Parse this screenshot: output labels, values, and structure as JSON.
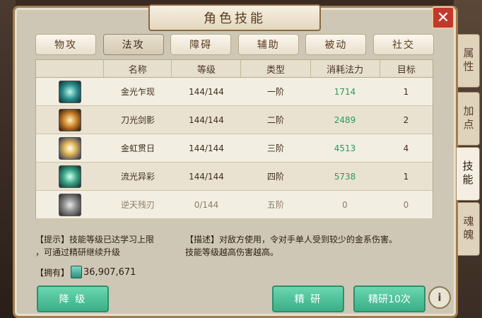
{
  "window": {
    "title": "角色技能",
    "close_label": "✕"
  },
  "tabs": [
    {
      "label": "物攻",
      "active": false
    },
    {
      "label": "法攻",
      "active": true
    },
    {
      "label": "障碍",
      "active": false
    },
    {
      "label": "辅助",
      "active": false
    },
    {
      "label": "被动",
      "active": false
    },
    {
      "label": "社交",
      "active": false
    }
  ],
  "table": {
    "headers": [
      "名称",
      "等级",
      "类型",
      "消耗法力",
      "目标"
    ],
    "rows": [
      {
        "icon": "skill-golden-light-icon",
        "name": "金光乍现",
        "level": "144/144",
        "type": "一阶",
        "cost": "1714",
        "target": "1"
      },
      {
        "icon": "skill-blade-shadow-icon",
        "name": "刀光剑影",
        "level": "144/144",
        "type": "二阶",
        "cost": "2489",
        "target": "2"
      },
      {
        "icon": "skill-golden-rainbow-icon",
        "name": "金虹贯日",
        "level": "144/144",
        "type": "三阶",
        "cost": "4513",
        "target": "4"
      },
      {
        "icon": "skill-flowing-light-icon",
        "name": "流光异彩",
        "level": "144/144",
        "type": "四阶",
        "cost": "5738",
        "target": "1"
      },
      {
        "icon": "skill-heaven-blade-icon",
        "name": "逆天残刃",
        "level": "0/144",
        "type": "五阶",
        "cost": "0",
        "target": "0"
      }
    ]
  },
  "hint": {
    "line1": "【提示】技能等级已达学习上限",
    "line2": "，可通过精研继续升级"
  },
  "description": {
    "line1": "【描述】对敌方使用，令对手单人受到较少的金系伤害。",
    "line2": "技能等级越高伤害越高。"
  },
  "owned": {
    "label": "【拥有】",
    "icon": "book-icon",
    "value": "36,907,671"
  },
  "buttons": {
    "downgrade": "降 级",
    "refine": "精 研",
    "refine10": "精研10次",
    "info": "i"
  },
  "side_tabs": [
    {
      "label": "属性",
      "active": false
    },
    {
      "label": "加点",
      "active": false
    },
    {
      "label": "技能",
      "active": true
    },
    {
      "label": "魂魄",
      "active": false
    }
  ],
  "colors": {
    "accent_green": "#3cae87",
    "cost_green": "#2a9a5a",
    "close_red": "#c0392b"
  }
}
